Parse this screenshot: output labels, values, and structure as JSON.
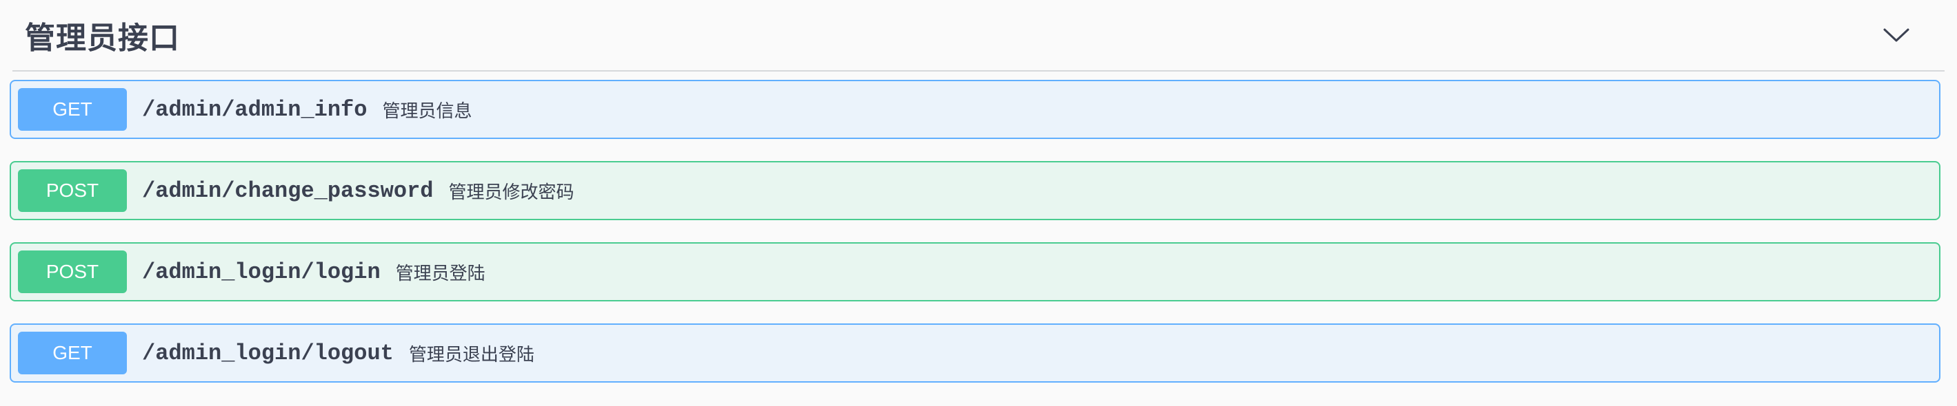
{
  "section": {
    "title": "管理员接口",
    "toggle_icon": "chevron-down-icon"
  },
  "operations": [
    {
      "method": "GET",
      "path": "/admin/admin_info",
      "summary": "管理员信息"
    },
    {
      "method": "POST",
      "path": "/admin/change_password",
      "summary": "管理员修改密码"
    },
    {
      "method": "POST",
      "path": "/admin_login/login",
      "summary": "管理员登陆"
    },
    {
      "method": "GET",
      "path": "/admin_login/logout",
      "summary": "管理员退出登陆"
    }
  ],
  "colors": {
    "get": "#61affe",
    "get_bg": "#ebf3fb",
    "post": "#49cc90",
    "post_bg": "#e8f6f0",
    "text": "#3b4151"
  }
}
